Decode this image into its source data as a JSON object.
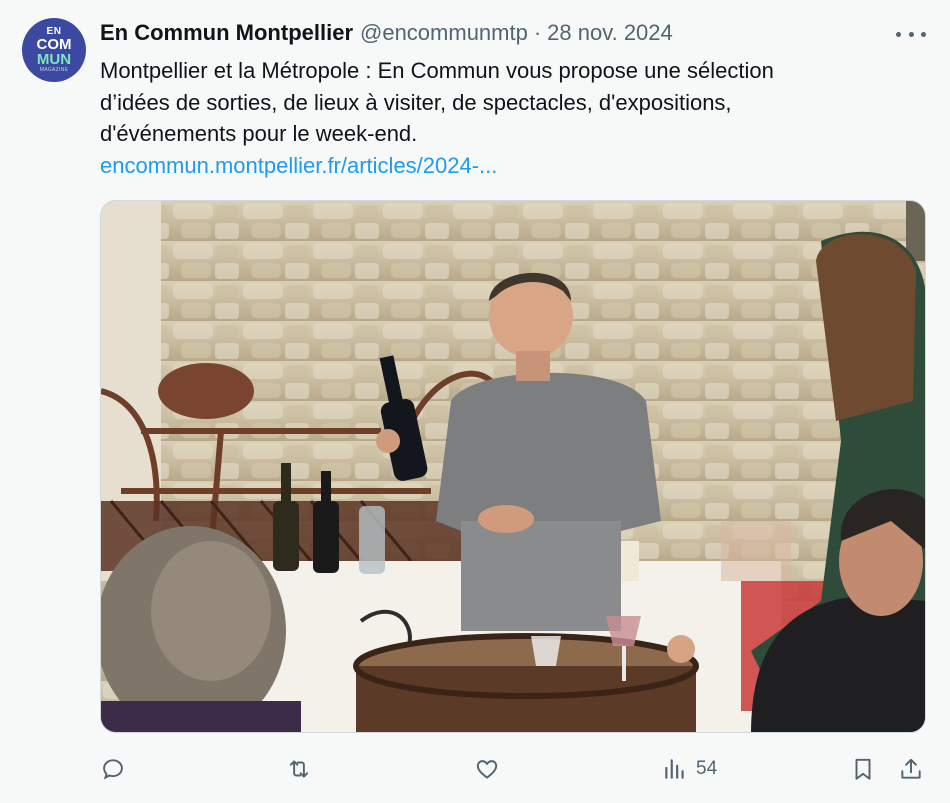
{
  "tweet": {
    "avatar": {
      "line1": "EN",
      "line2": "COM",
      "line3": "MUN",
      "line4": "MAGAZINE",
      "bg_color": "#3b4aa0"
    },
    "author_name": "En Commun Montpellier",
    "handle": "@encommunmtp",
    "separator": "·",
    "date": "28 nov. 2024",
    "more_icon": "more-horizontal-icon",
    "text_lines": [
      "Montpellier et la Métropole : En Commun vous propose une sélection",
      "d’idées de sorties, de lieux à  visiter, de spectacles, d'expositions,",
      "d'événements pour le week-end."
    ],
    "link_text": "encommun.montpellier.fr/articles/2024-...",
    "link_color": "#1d9bf0",
    "media": {
      "icon": "photo-wine-tasting-outdoor"
    },
    "actions": {
      "reply_icon": "reply-icon",
      "retweet_icon": "retweet-icon",
      "like_icon": "heart-icon",
      "views_icon": "views-chart-icon",
      "views_count": "54",
      "bookmark_icon": "bookmark-icon",
      "share_icon": "share-icon"
    }
  }
}
